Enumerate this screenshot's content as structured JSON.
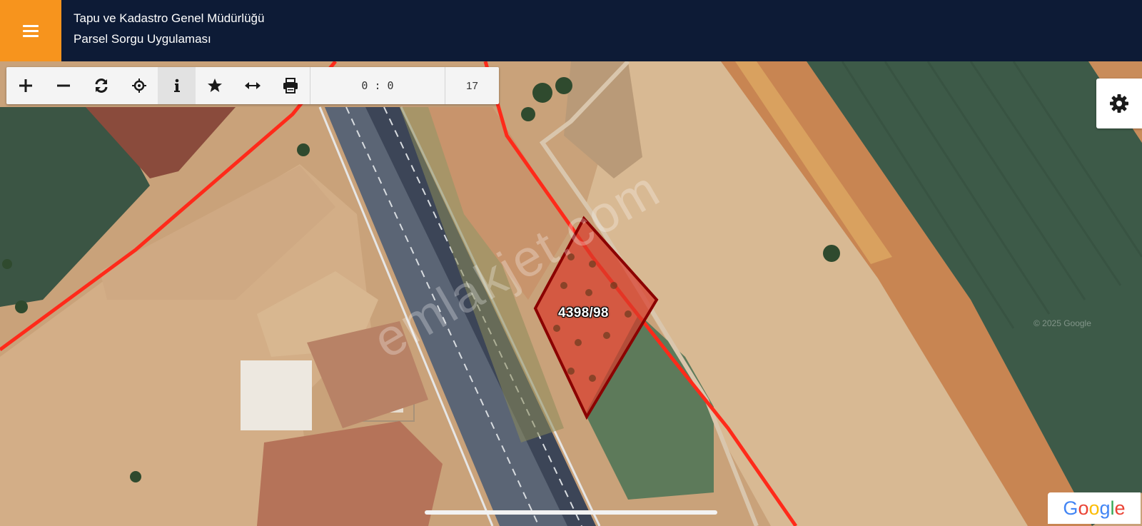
{
  "header": {
    "title_line1": "Tapu ve Kadastro Genel Müdürlüğü",
    "title_line2": "Parsel Sorgu Uygulaması",
    "menu_icon": "hamburger-menu-icon",
    "accent_color": "#f7941d",
    "background_color": "#0d1b36"
  },
  "toolbar": {
    "buttons": [
      {
        "name": "zoom-in",
        "icon": "plus-icon"
      },
      {
        "name": "zoom-out",
        "icon": "minus-icon"
      },
      {
        "name": "refresh",
        "icon": "refresh-icon"
      },
      {
        "name": "locate",
        "icon": "crosshair-icon"
      },
      {
        "name": "info",
        "icon": "info-icon",
        "active": true
      },
      {
        "name": "favorite",
        "icon": "star-icon"
      },
      {
        "name": "measure",
        "icon": "arrows-horizontal-icon"
      },
      {
        "name": "print",
        "icon": "printer-icon"
      }
    ],
    "coordinates": "0 : 0",
    "zoom_level": "17"
  },
  "settings": {
    "icon": "gear-icon"
  },
  "map": {
    "parcel_label": "4398/98",
    "parcel_fill_color": "#d93a2b",
    "parcel_border_color": "#8b0000",
    "boundary_line_color": "#ff2a1a",
    "watermark_text": "emlakjet.com",
    "copyright_text": "© 2025 Google",
    "attribution_logo": "Google"
  }
}
